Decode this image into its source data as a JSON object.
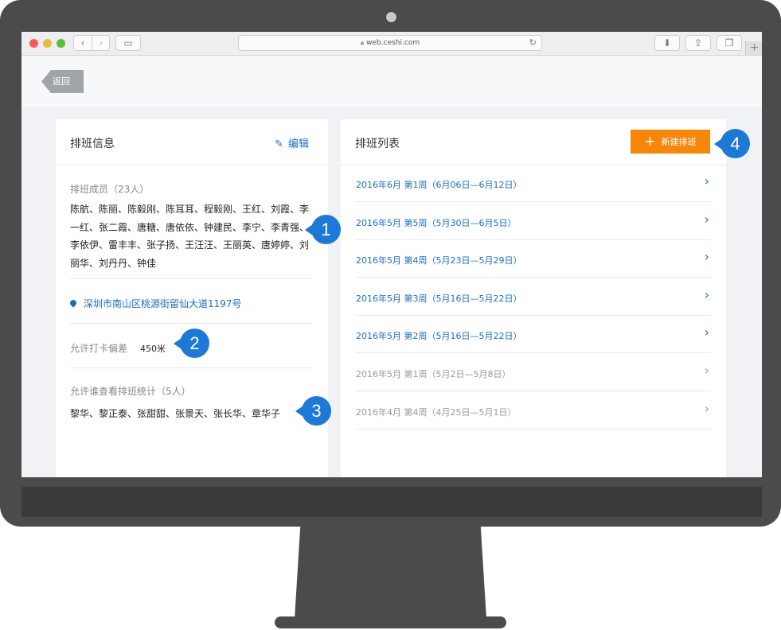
{
  "browser": {
    "url": "web.ceshi.com"
  },
  "topbar": {
    "back_label": "返回"
  },
  "schedule_info": {
    "title": "排班信息",
    "edit_label": "编辑",
    "members_label": "排班成员（23人）",
    "members": "陈航、陈丽、陈毅刚、陈耳耳、程毅刚、王红、刘霞、李一红、张二霞、唐糖、唐依依、钟建民、李宁、李青强、李依伊、雷丰丰、张子扬、王汪汪、王丽英、唐婷婷、刘丽华、刘丹丹、钟佳",
    "address": "深圳市南山区桃源街留仙大道1197号",
    "tolerance_label": "允许打卡偏差",
    "tolerance_value": "450米",
    "viewers_label": "允许谁查看排班统计（5人）",
    "viewers": "黎华、黎正泰、张甜甜、张景天、张长华、章华子"
  },
  "schedule_list": {
    "title": "排班列表",
    "new_label": "新建排班",
    "items": [
      {
        "label": "2016年6月 第1周（6月06日—6月12日）",
        "state": "active"
      },
      {
        "label": "2016年5月 第5周（5月30日—6月5日）",
        "state": "active"
      },
      {
        "label": "2016年5月 第4周（5月23日—5月29日）",
        "state": "active"
      },
      {
        "label": "2016年5月 第3周（5月16日—5月22日）",
        "state": "active"
      },
      {
        "label": "2016年5月 第2周（5月16日—5月22日）",
        "state": "active"
      },
      {
        "label": "2016年5月 第1周（5月2日—5月8日）",
        "state": "past"
      },
      {
        "label": "2016年4月 第4周（4月25日—5月1日）",
        "state": "past"
      }
    ]
  },
  "callouts": [
    "1",
    "2",
    "3",
    "4"
  ],
  "colors": {
    "accent": "#1a6ec2",
    "primary_button": "#f7870b",
    "callout": "#1e78d6"
  }
}
